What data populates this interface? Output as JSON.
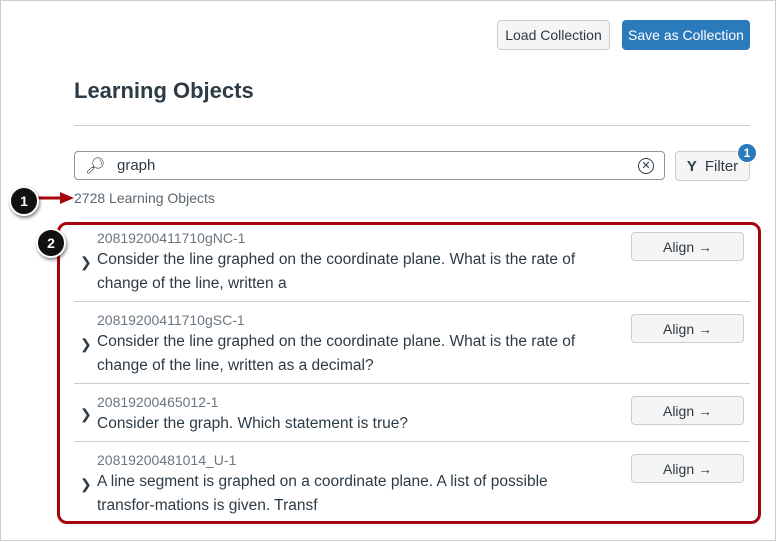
{
  "header": {
    "load_label": "Load Collection",
    "save_label": "Save as Collection"
  },
  "title": "Learning Objects",
  "search": {
    "value": "graph",
    "placeholder": ""
  },
  "filter": {
    "label": "Filter",
    "badge": "1"
  },
  "count": "2728 Learning Objects",
  "align_label": "Align →",
  "items": [
    {
      "id": "20819200411710gNC-1",
      "text": "Consider the line graphed on the coordinate plane. What is the rate of change of the line, written a"
    },
    {
      "id": "20819200411710gSC-1",
      "text": "Consider the line graphed on the coordinate plane. What is the rate of change of the line, written as a decimal?"
    },
    {
      "id": "20819200465012-1",
      "text": "Consider the graph. Which statement is true?"
    },
    {
      "id": "20819200481014_U-1",
      "text": "A line segment is graphed on a coordinate plane. A list of possible transfor-mations is given. Transf"
    }
  ],
  "callouts": [
    "1",
    "2"
  ],
  "colors": {
    "accent": "#2b7abc",
    "annotation": "#a5060d"
  }
}
